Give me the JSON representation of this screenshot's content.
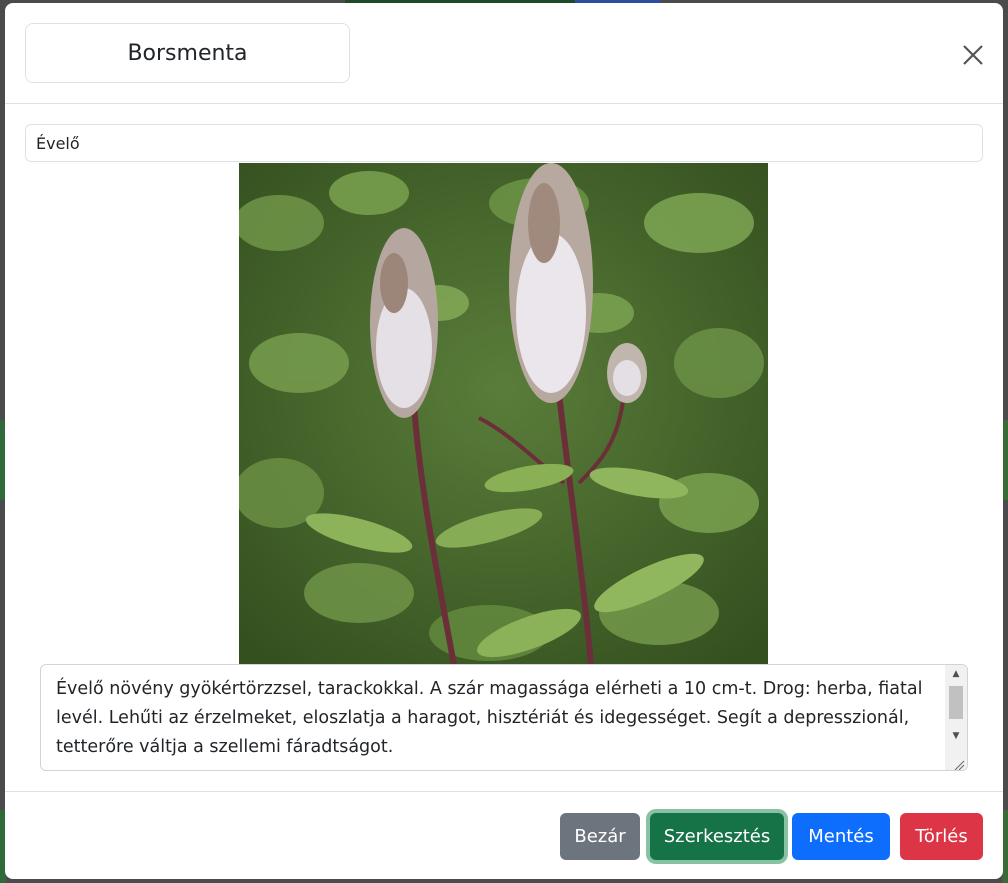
{
  "modal": {
    "title": "Borsmenta",
    "type": "Évelő",
    "description": "Évelő növény gyökértörzzsel, tarackokkal. A szár magassága elérheti a 10 cm-t. Drog: herba, fiatal levél. Lehűti az érzelmeket, eloszlatja a haragot, hisztériát és idegességet. Segít a depresszionál, tetterőre váltja a szellemi fáradtságot."
  },
  "footer": {
    "close_label": "Bezár",
    "edit_label": "Szerkesztés",
    "save_label": "Mentés",
    "delete_label": "Törlés"
  },
  "icons": {
    "close": "close-icon",
    "scroll_up": "scroll-up-icon",
    "scroll_down": "scroll-down-icon",
    "resize": "resize-grip-icon"
  },
  "colors": {
    "secondary": "#6c757d",
    "success": "#157347",
    "primary": "#0d6efd",
    "danger": "#dc3545"
  }
}
